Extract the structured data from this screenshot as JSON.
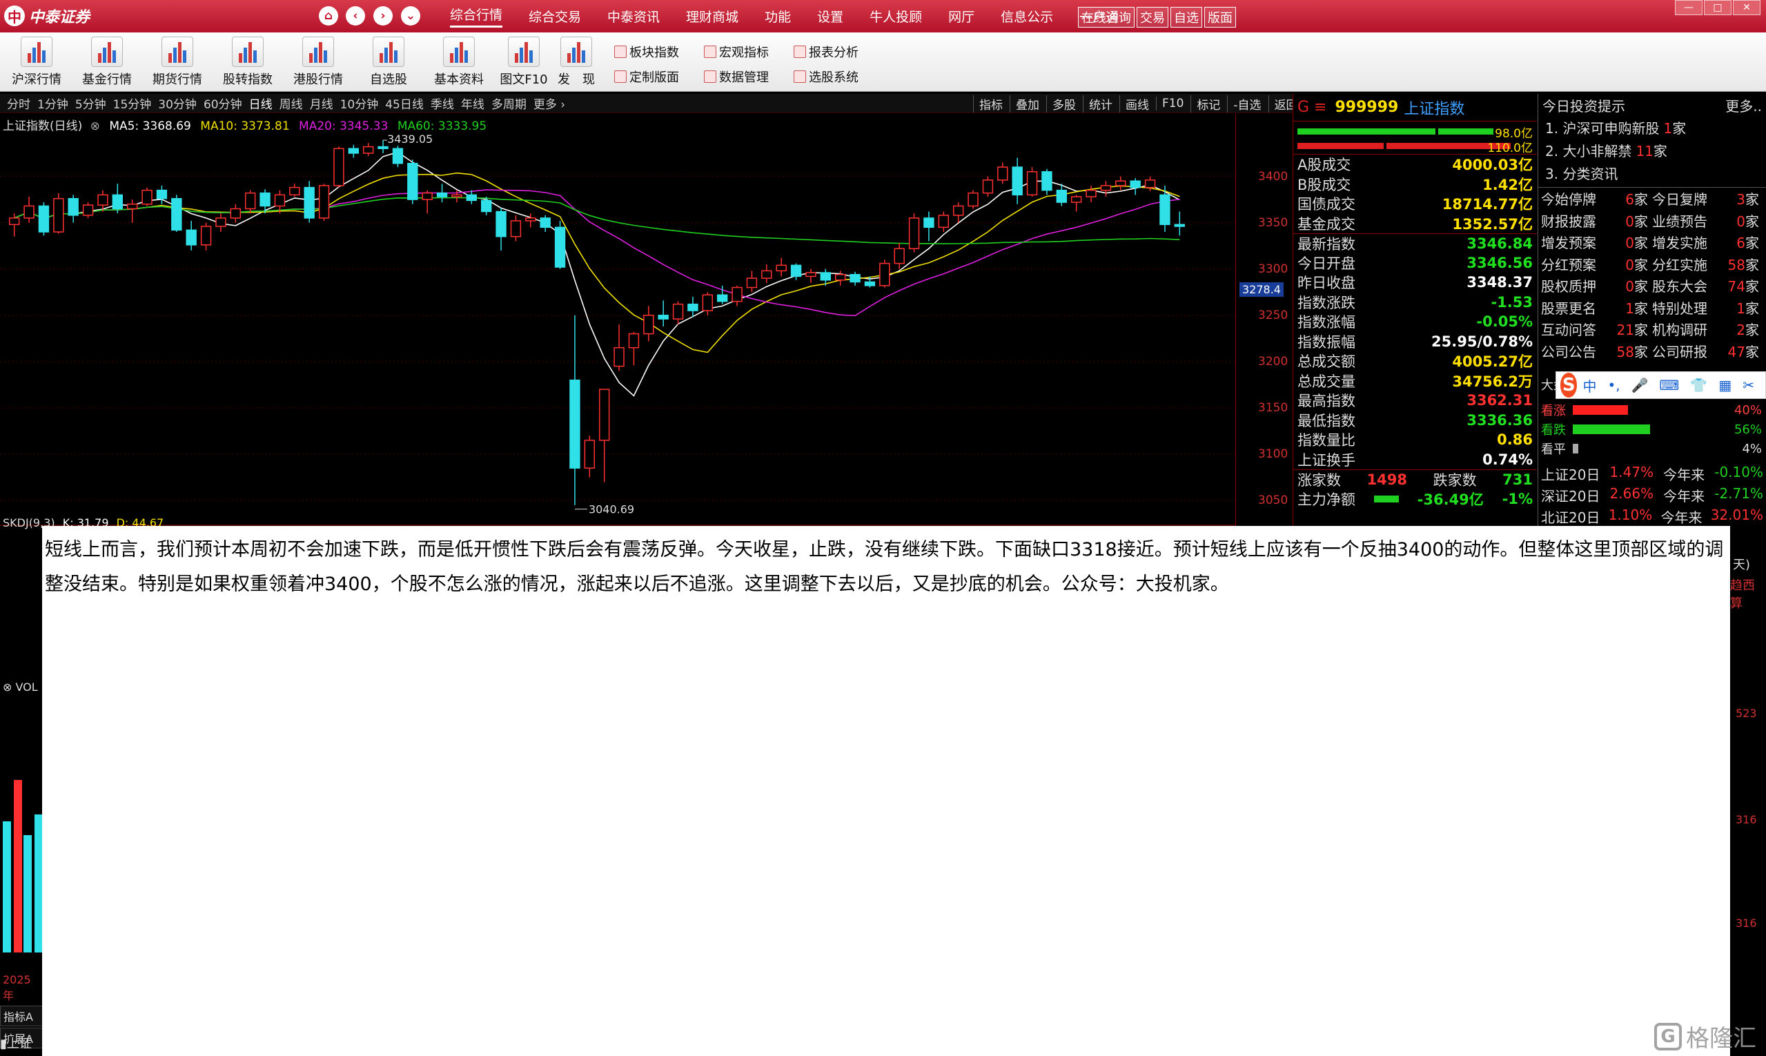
{
  "titlebar": {
    "logo_mark": "中",
    "brand": "中泰证券",
    "nav": {
      "home": "⌂",
      "back": "‹",
      "forward": "›",
      "down": "⌄"
    },
    "menu": [
      "综合行情",
      "综合交易",
      "中泰资讯",
      "理财商城",
      "功能",
      "设置",
      "牛人投顾",
      "网厅",
      "信息公示",
      "一户通"
    ],
    "menu_active_index": 0,
    "quick": [
      "在线咨询",
      "交易",
      "自选",
      "版面"
    ],
    "window_controls": [
      "—",
      "□",
      "✕"
    ]
  },
  "toolbar": {
    "big": [
      {
        "label": "沪深行情",
        "icon": "line-chart-icon"
      },
      {
        "label": "基金行情",
        "icon": "bar-chart-icon"
      },
      {
        "label": "期货行情",
        "icon": "bar-chart-icon"
      },
      {
        "label": "股转指数",
        "icon": "candles-icon"
      },
      {
        "label": "港股行情",
        "icon": "building-chart-icon"
      },
      {
        "label": "自选股",
        "icon": "target-icon"
      },
      {
        "label": "基本资料",
        "icon": "key-icon"
      },
      {
        "label": "图文F10",
        "icon": "pen-icon"
      },
      {
        "label": "发　现",
        "icon": "discover-chart-icon"
      }
    ],
    "small": [
      {
        "label": "板块指数",
        "icon": "sector-icon"
      },
      {
        "label": "宏观指标",
        "icon": "macro-icon"
      },
      {
        "label": "报表分析",
        "icon": "report-icon"
      },
      {
        "label": "定制版面",
        "icon": "layout-icon"
      },
      {
        "label": "数据管理",
        "icon": "data-icon"
      },
      {
        "label": "选股系统",
        "icon": "screener-icon"
      }
    ]
  },
  "periods": [
    "分时",
    "1分钟",
    "5分钟",
    "15分钟",
    "30分钟",
    "60分钟",
    "日线",
    "周线",
    "月线",
    "10分钟",
    "45日线",
    "季线",
    "年线",
    "多周期",
    "更多 ›"
  ],
  "period_selected_index": 6,
  "chart_tools": [
    "指标",
    "叠加",
    "多股",
    "统计",
    "画线",
    "F10",
    "标记",
    "-自选",
    "返回"
  ],
  "chart_info": {
    "title": "上证指数(日线)",
    "ma5": "MA5: 3368.69",
    "ma10": "MA10: 3373.81",
    "ma20": "MA20: 3345.33",
    "ma60": "MA60: 3333.95"
  },
  "chart_data": {
    "type": "candlestick",
    "title": "上证指数(日线)",
    "y_ticks": [
      3400,
      3350,
      3300,
      3250,
      3200,
      3150,
      3100,
      3050
    ],
    "ylim": [
      3030,
      3460
    ],
    "annotations": {
      "high": "3439.05",
      "low": "3040.69"
    },
    "current_price_label": "3278.4",
    "candles": [
      [
        3348,
        3360,
        3335,
        3355
      ],
      [
        3355,
        3378,
        3350,
        3368
      ],
      [
        3368,
        3372,
        3336,
        3340
      ],
      [
        3340,
        3382,
        3338,
        3376
      ],
      [
        3376,
        3380,
        3350,
        3358
      ],
      [
        3358,
        3372,
        3355,
        3369
      ],
      [
        3369,
        3385,
        3362,
        3380
      ],
      [
        3380,
        3392,
        3360,
        3365
      ],
      [
        3365,
        3375,
        3350,
        3370
      ],
      [
        3370,
        3388,
        3368,
        3385
      ],
      [
        3385,
        3390,
        3370,
        3376
      ],
      [
        3376,
        3380,
        3340,
        3342
      ],
      [
        3342,
        3352,
        3320,
        3326
      ],
      [
        3326,
        3350,
        3320,
        3346
      ],
      [
        3346,
        3360,
        3340,
        3355
      ],
      [
        3355,
        3370,
        3350,
        3365
      ],
      [
        3365,
        3385,
        3360,
        3382
      ],
      [
        3382,
        3386,
        3360,
        3368
      ],
      [
        3368,
        3385,
        3360,
        3380
      ],
      [
        3380,
        3392,
        3378,
        3388
      ],
      [
        3388,
        3395,
        3350,
        3355
      ],
      [
        3355,
        3392,
        3352,
        3390
      ],
      [
        3390,
        3432,
        3388,
        3430
      ],
      [
        3430,
        3434,
        3420,
        3425
      ],
      [
        3425,
        3436,
        3422,
        3432
      ],
      [
        3432,
        3439,
        3425,
        3430
      ],
      [
        3430,
        3433,
        3410,
        3414
      ],
      [
        3414,
        3418,
        3370,
        3375
      ],
      [
        3375,
        3385,
        3360,
        3382
      ],
      [
        3382,
        3392,
        3372,
        3378
      ],
      [
        3378,
        3385,
        3372,
        3380
      ],
      [
        3380,
        3385,
        3370,
        3374
      ],
      [
        3374,
        3378,
        3358,
        3362
      ],
      [
        3362,
        3366,
        3320,
        3335
      ],
      [
        3335,
        3358,
        3330,
        3352
      ],
      [
        3352,
        3360,
        3345,
        3355
      ],
      [
        3355,
        3358,
        3340,
        3345
      ],
      [
        3345,
        3352,
        3300,
        3302
      ],
      [
        3180,
        3250,
        3045,
        3085
      ],
      [
        3085,
        3120,
        3075,
        3115
      ],
      [
        3115,
        3170,
        3070,
        3170
      ],
      [
        3195,
        3240,
        3190,
        3215
      ],
      [
        3215,
        3232,
        3196,
        3230
      ],
      [
        3230,
        3260,
        3222,
        3250
      ],
      [
        3250,
        3266,
        3238,
        3246
      ],
      [
        3246,
        3265,
        3240,
        3262
      ],
      [
        3262,
        3270,
        3248,
        3255
      ],
      [
        3255,
        3275,
        3250,
        3272
      ],
      [
        3272,
        3282,
        3262,
        3265
      ],
      [
        3265,
        3282,
        3260,
        3280
      ],
      [
        3280,
        3298,
        3275,
        3290
      ],
      [
        3290,
        3305,
        3285,
        3298
      ],
      [
        3298,
        3312,
        3292,
        3304
      ],
      [
        3304,
        3306,
        3288,
        3292
      ],
      [
        3292,
        3300,
        3285,
        3296
      ],
      [
        3296,
        3300,
        3282,
        3288
      ],
      [
        3288,
        3298,
        3282,
        3294
      ],
      [
        3294,
        3297,
        3282,
        3286
      ],
      [
        3286,
        3292,
        3280,
        3282
      ],
      [
        3282,
        3310,
        3280,
        3306
      ],
      [
        3306,
        3328,
        3300,
        3322
      ],
      [
        3322,
        3360,
        3318,
        3355
      ],
      [
        3355,
        3362,
        3330,
        3345
      ],
      [
        3345,
        3362,
        3340,
        3358
      ],
      [
        3358,
        3372,
        3350,
        3368
      ],
      [
        3368,
        3385,
        3365,
        3382
      ],
      [
        3382,
        3400,
        3378,
        3396
      ],
      [
        3396,
        3415,
        3392,
        3410
      ],
      [
        3410,
        3420,
        3370,
        3380
      ],
      [
        3380,
        3410,
        3378,
        3405
      ],
      [
        3405,
        3408,
        3380,
        3385
      ],
      [
        3385,
        3392,
        3368,
        3372
      ],
      [
        3372,
        3380,
        3362,
        3378
      ],
      [
        3378,
        3390,
        3372,
        3385
      ],
      [
        3385,
        3395,
        3378,
        3390
      ],
      [
        3390,
        3400,
        3385,
        3395
      ],
      [
        3395,
        3398,
        3380,
        3388
      ],
      [
        3388,
        3400,
        3384,
        3396
      ],
      [
        3380,
        3390,
        3340,
        3348
      ],
      [
        3348,
        3362,
        3336,
        3346
      ]
    ]
  },
  "skdj_label": {
    "name": "SKDJ(9,3)",
    "k": "K: 31.79",
    "d": "D: 44.67"
  },
  "vol_label": "VOL",
  "left_tabs": [
    "2025年",
    "指标A",
    "扩展A"
  ],
  "bottom_left": "上证",
  "note": "短线上而言，我们预计本周初不会加速下跌，而是低开惯性下跌后会有震荡反弹。今天收星，止跌，没有继续下跌。下面缺口3318接近。预计短线上应该有一个反抽3400的动作。但整体这里顶部区域的调整没结束。特别是如果权重领着冲3400，个股不怎么涨的情况，涨起来以后不追涨。这里调整下去以后，又是抄底的机会。公众号：大投机家。",
  "quote": {
    "prefix": "G ≡",
    "code": "999999",
    "name": "上证指数",
    "bars": [
      {
        "value": "98.0亿"
      },
      {
        "value": "110.0亿"
      }
    ],
    "rows": [
      {
        "label": "A股成交",
        "value": "4000.03亿",
        "color": "yel"
      },
      {
        "label": "B股成交",
        "value": "1.42亿",
        "color": "yel"
      },
      {
        "label": "国债成交",
        "value": "18714.77亿",
        "color": "yel"
      },
      {
        "label": "基金成交",
        "value": "1352.57亿",
        "color": "yel"
      },
      {
        "label": "最新指数",
        "value": "3346.84",
        "color": "grn"
      },
      {
        "label": "今日开盘",
        "value": "3346.56",
        "color": "grn"
      },
      {
        "label": "昨日收盘",
        "value": "3348.37",
        "color": "wht"
      },
      {
        "label": "指数涨跌",
        "value": "-1.53",
        "color": "grn"
      },
      {
        "label": "指数涨幅",
        "value": "-0.05%",
        "color": "grn"
      },
      {
        "label": "指数振幅",
        "value": "25.95/0.78%",
        "color": "wht"
      },
      {
        "label": "总成交额",
        "value": "4005.27亿",
        "color": "yel"
      },
      {
        "label": "总成交量",
        "value": "34756.2万",
        "color": "yel"
      },
      {
        "label": "最高指数",
        "value": "3362.31",
        "color": "red"
      },
      {
        "label": "最低指数",
        "value": "3336.36",
        "color": "grn"
      },
      {
        "label": "指数量比",
        "value": "0.86",
        "color": "yel"
      },
      {
        "label": "上证换手",
        "value": "0.74%",
        "color": "wht"
      }
    ],
    "updown": {
      "up_label": "涨家数",
      "up": "1498",
      "down_label": "跌家数",
      "down": "731"
    },
    "netflow": {
      "label": "主力净额",
      "value": "-36.49亿",
      "pct": "-1%"
    }
  },
  "info": {
    "title": "今日投资提示",
    "more": "更多..",
    "tips": [
      {
        "text": "1. 沪深可申购新股",
        "num": "1",
        "unit": "家"
      },
      {
        "text": "2. 大小非解禁",
        "num": "11",
        "unit": "家"
      },
      {
        "text": "3. 分类资讯",
        "num": "",
        "unit": ""
      }
    ],
    "grid": [
      [
        {
          "l": "今始停牌",
          "v": "6",
          "u": "家"
        },
        {
          "l": "今日复牌",
          "v": "3",
          "u": "家"
        }
      ],
      [
        {
          "l": "财报披露",
          "v": "0",
          "u": "家"
        },
        {
          "l": "业绩预告",
          "v": "0",
          "u": "家"
        }
      ],
      [
        {
          "l": "增发预案",
          "v": "0",
          "u": "家"
        },
        {
          "l": "增发实施",
          "v": "6",
          "u": "家"
        }
      ],
      [
        {
          "l": "分红预案",
          "v": "0",
          "u": "家"
        },
        {
          "l": "分红实施",
          "v": "58",
          "u": "家"
        }
      ],
      [
        {
          "l": "股权质押",
          "v": "0",
          "u": "家"
        },
        {
          "l": "股东大会",
          "v": "74",
          "u": "家"
        }
      ],
      [
        {
          "l": "股票更名",
          "v": "1",
          "u": "家"
        },
        {
          "l": "特别处理",
          "v": "1",
          "u": "家"
        }
      ],
      [
        {
          "l": "互动问答",
          "v": "21",
          "u": "家"
        },
        {
          "l": "机构调研",
          "v": "2",
          "u": "家"
        }
      ],
      [
        {
          "l": "公司公告",
          "v": "58",
          "u": "家"
        },
        {
          "l": "公司研报",
          "v": "47",
          "u": "家"
        }
      ]
    ],
    "ime": {
      "logo": "S",
      "items": [
        "中",
        "•,",
        "🎤",
        "⌨",
        "👕",
        "▦",
        "✂"
      ]
    },
    "sentiment_label": "大盘",
    "sentiment": [
      {
        "label": "看涨",
        "pct": "40%",
        "color": "#ff2020",
        "fraction": 0.4
      },
      {
        "label": "看跌",
        "pct": "56%",
        "color": "#20d020",
        "fraction": 0.56
      },
      {
        "label": "看平",
        "pct": "4%",
        "color": "#aaaaaa",
        "fraction": 0.04
      }
    ],
    "index_rows": [
      {
        "l": "上证20日",
        "v": "1.47%",
        "l2": "今年来",
        "v2": "-0.10%"
      },
      {
        "l": "深证20日",
        "v": "2.66%",
        "l2": "今年来",
        "v2": "-2.71%"
      },
      {
        "l": "北证20日",
        "v": "1.10%",
        "l2": "今年来",
        "v2": "32.01%"
      }
    ]
  },
  "right_edge": {
    "a": "天)",
    "b": "趋西算",
    "c": "523",
    "d": "316",
    "e": "316"
  },
  "watermark": {
    "icon": "G",
    "text": "格隆汇"
  }
}
